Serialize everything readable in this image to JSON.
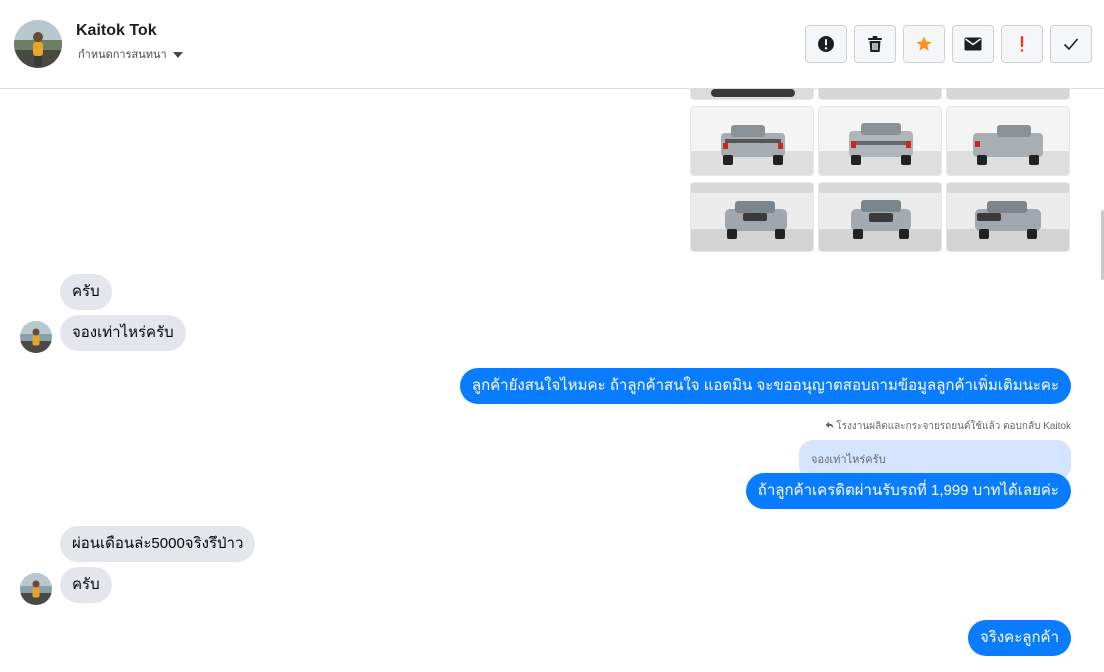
{
  "header": {
    "contact_name": "Kaitok Tok",
    "subtitle": "กำหนดการสนทนา",
    "actions": [
      {
        "name": "report",
        "icon": "alert-circle-icon",
        "color": "#1c1e21"
      },
      {
        "name": "delete",
        "icon": "trash-icon",
        "color": "#1c1e21"
      },
      {
        "name": "star",
        "icon": "star-icon",
        "color": "#f7931e"
      },
      {
        "name": "mark-unread",
        "icon": "envelope-icon",
        "color": "#1c1e21"
      },
      {
        "name": "mark-important",
        "icon": "exclamation-icon",
        "color": "#e03e2d"
      },
      {
        "name": "mark-done",
        "icon": "checkmark-icon",
        "color": "#1c1e21"
      }
    ]
  },
  "messages": [
    {
      "from": "contact",
      "text": "ครับ"
    },
    {
      "from": "contact",
      "text": "จองเท่าไหร่ครับ"
    },
    {
      "from": "page",
      "text": "ลูกค้ายังสนใจไหมคะ ถ้าลูกค้าสนใจ แอดมิน จะขออนุญาตสอบถามข้อมูลลูกค้าเพิ่มเติมนะคะ"
    },
    {
      "from": "page",
      "reply_meta": "โรงงานผลิตและกระจายรถยนต์ใช้แล้ว ตอบกลับ Kaitok",
      "quoted": "จองเท่าไหร่ครับ",
      "text": "ถ้าลูกค้าเครดิตผ่านรับรถที่ 1,999 บาทได้เลยค่ะ"
    },
    {
      "from": "contact",
      "text": "ผ่อนเดือนล่ะ5000จริงรึป่าว"
    },
    {
      "from": "contact",
      "text": "ครับ"
    },
    {
      "from": "page",
      "text": "จริงคะลูกค้า"
    }
  ],
  "colors": {
    "outgoing_bubble": "#0a7cff",
    "incoming_bubble": "#e4e6eb",
    "quote_bubble": "#d5e5ff"
  }
}
